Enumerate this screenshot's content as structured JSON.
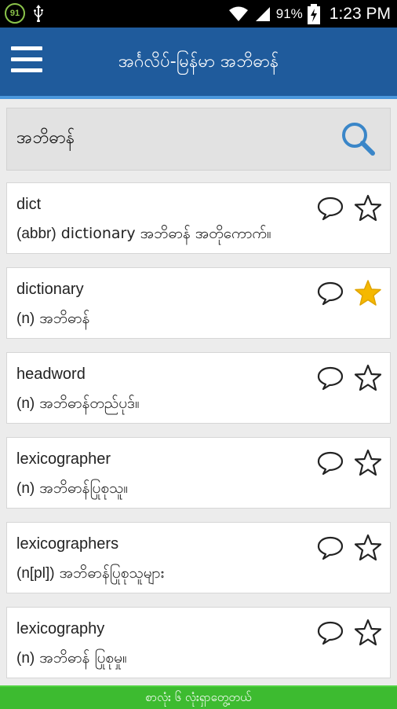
{
  "status_bar": {
    "notification_badge": "91",
    "battery": "91%",
    "time": "1:23 PM"
  },
  "app_bar": {
    "title": "အင်္ဂလိပ်-မြန်မာ အဘိဓာန်"
  },
  "search": {
    "value": "အဘိဓာန်"
  },
  "entries": [
    {
      "word": "dict",
      "pos": "(abbr)",
      "definition": " dictionary အဘိဓာန် အတိုကောက်။",
      "starred": false
    },
    {
      "word": "dictionary",
      "pos": "(n)",
      "definition": " အဘိဓာန်",
      "starred": true
    },
    {
      "word": "headword",
      "pos": "(n)",
      "definition": " အဘိဓာန်တည်ပုဒ်။",
      "starred": false
    },
    {
      "word": "lexicographer",
      "pos": "(n)",
      "definition": " အဘိဓာန်ပြုစုသူ။",
      "starred": false
    },
    {
      "word": "lexicographers",
      "pos": "(n[pl])",
      "definition": " အဘိဓာန်ပြုစုသူများ",
      "starred": false
    },
    {
      "word": "lexicography",
      "pos": "(n)",
      "definition": " အဘိဓာန် ပြုစုမှု။",
      "starred": false
    }
  ],
  "footer": {
    "result_text": "စာလုံး ၆ လုံးရှာတွေ့တယ်"
  },
  "colors": {
    "app_bar": "#1f5b9c",
    "footer": "#3dbb30",
    "star_active": "#f5b800",
    "search_icon": "#3a86c8"
  }
}
